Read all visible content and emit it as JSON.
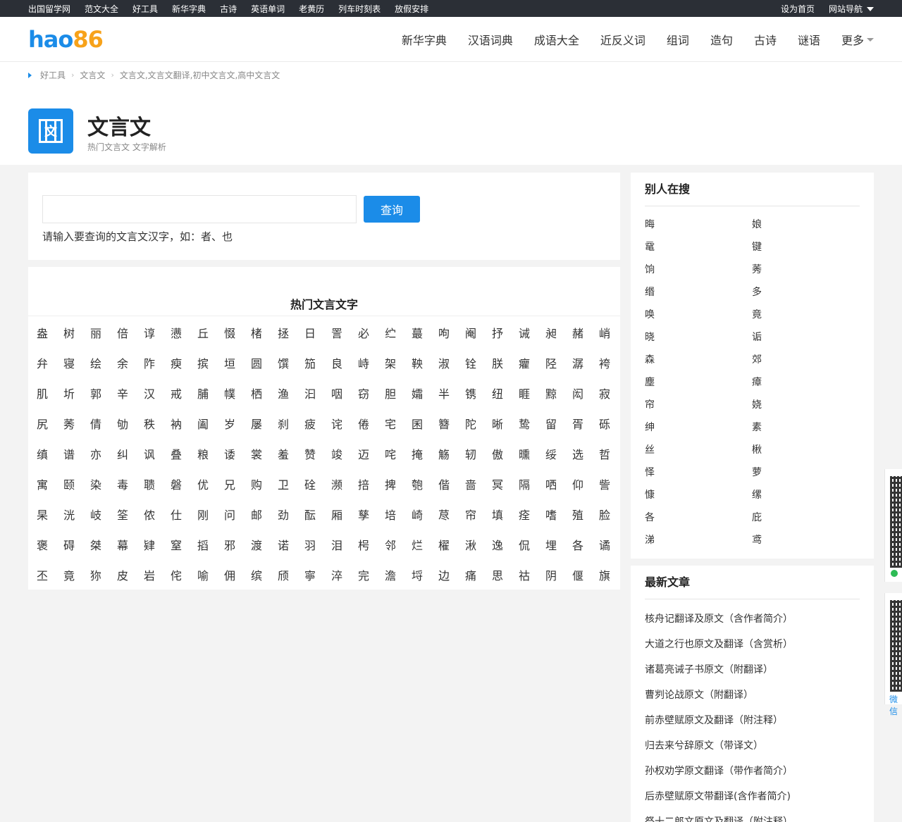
{
  "topbar": {
    "links": [
      "出国留学网",
      "范文大全",
      "好工具",
      "新华字典",
      "古诗",
      "英语单词",
      "老黄历",
      "列车时刻表",
      "放假安排"
    ],
    "set_home": "设为首页",
    "site_nav": "网站导航"
  },
  "header": {
    "logo_hao": "hao",
    "logo_num": "86",
    "nav": [
      "新华字典",
      "汉语词典",
      "成语大全",
      "近反义词",
      "组词",
      "造句",
      "古诗",
      "谜语"
    ],
    "more": "更多"
  },
  "breadcrumb": [
    "好工具",
    "文言文",
    "文言文,文言文翻译,初中文言文,高中文言文"
  ],
  "hero": {
    "icon_char": "文",
    "title": "文言文",
    "subtitle": "热门文言文 文字解析"
  },
  "search": {
    "value": "",
    "placeholder": "",
    "button": "查询",
    "hint": "请输入要查询的文言文汉字，如：者、也"
  },
  "hot": {
    "title": "热门文言文字",
    "chars": [
      "盎",
      "树",
      "丽",
      "倍",
      "谆",
      "懑",
      "丘",
      "惙",
      "楮",
      "拯",
      "日",
      "詈",
      "必",
      "纻",
      "蕞",
      "呴",
      "阉",
      "抒",
      "诫",
      "昶",
      "赭",
      "峭",
      "弁",
      "寝",
      "绘",
      "余",
      "阼",
      "瘐",
      "摈",
      "垣",
      "圆",
      "馔",
      "笳",
      "良",
      "峙",
      "架",
      "鞅",
      "淑",
      "铨",
      "朕",
      "癯",
      "陉",
      "潺",
      "袴",
      "肌",
      "圻",
      "郭",
      "辛",
      "汉",
      "戒",
      "脯",
      "幞",
      "栖",
      "渔",
      "汩",
      "咽",
      "窃",
      "胆",
      "孀",
      "半",
      "镌",
      "纽",
      "睚",
      "黥",
      "闳",
      "寂",
      "尻",
      "莠",
      "倩",
      "劬",
      "秩",
      "衲",
      "阖",
      "岁",
      "屡",
      "刹",
      "疲",
      "诧",
      "倦",
      "宅",
      "囷",
      "簪",
      "陀",
      "晰",
      "鸷",
      "留",
      "胥",
      "砾",
      "缜",
      "谱",
      "亦",
      "纠",
      "讽",
      "叠",
      "粮",
      "诿",
      "裳",
      "羞",
      "赞",
      "竣",
      "迈",
      "咤",
      "掩",
      "觞",
      "轫",
      "傲",
      "曛",
      "绥",
      "选",
      "哲",
      "寓",
      "颐",
      "染",
      "毒",
      "聩",
      "磐",
      "优",
      "兄",
      "购",
      "卫",
      "硂",
      "濒",
      "掊",
      "捭",
      "匏",
      "偕",
      "啬",
      "冥",
      "隔",
      "哂",
      "仰",
      "訾",
      "杲",
      "洸",
      "岐",
      "筌",
      "侬",
      "仕",
      "刚",
      "问",
      "邮",
      "劲",
      "酝",
      "厢",
      "孳",
      "培",
      "崎",
      "荩",
      "帘",
      "填",
      "痊",
      "嗜",
      "殖",
      "脸",
      "褒",
      "碍",
      "桀",
      "幕",
      "肄",
      "窒",
      "搯",
      "邪",
      "渡",
      "诺",
      "羽",
      "泪",
      "枵",
      "邻",
      "烂",
      "櫂",
      "湫",
      "逸",
      "侃",
      "埋",
      "各",
      "谲",
      "丕",
      "竟",
      "狝",
      "皮",
      "岩",
      "侘",
      "喻",
      "佣",
      "缤",
      "颀",
      "寧",
      "淬",
      "完",
      "澹",
      "埒",
      "边",
      "痛",
      "思",
      "祜",
      "阴",
      "偃",
      "旗"
    ]
  },
  "others_search": {
    "title": "别人在搜",
    "items": [
      "晦",
      "娘",
      "鼋",
      "键",
      "饷",
      "莠",
      "缗",
      "多",
      "唤",
      "竟",
      "晓",
      "诟",
      "森",
      "郊",
      "塵",
      "瘴",
      "帘",
      "娆",
      "绅",
      "素",
      "丝",
      "楸",
      "怿",
      "萝",
      "慷",
      "缧",
      "各",
      "庇",
      "涕",
      "鸢"
    ]
  },
  "latest": {
    "title": "最新文章",
    "items": [
      "核舟记翻译及原文（含作者简介）",
      "大道之行也原文及翻译（含赏析）",
      "诸葛亮诫子书原文（附翻译）",
      "曹刿论战原文（附翻译）",
      "前赤壁赋原文及翻译（附注释）",
      "归去来兮辞原文（带译文）",
      "孙权劝学原文翻译（带作者简介）",
      "后赤壁赋原文带翻译(含作者简介)",
      "祭十二郎文原文及翻译（附注释）"
    ]
  },
  "floating": {
    "wechat_label": "微信"
  }
}
